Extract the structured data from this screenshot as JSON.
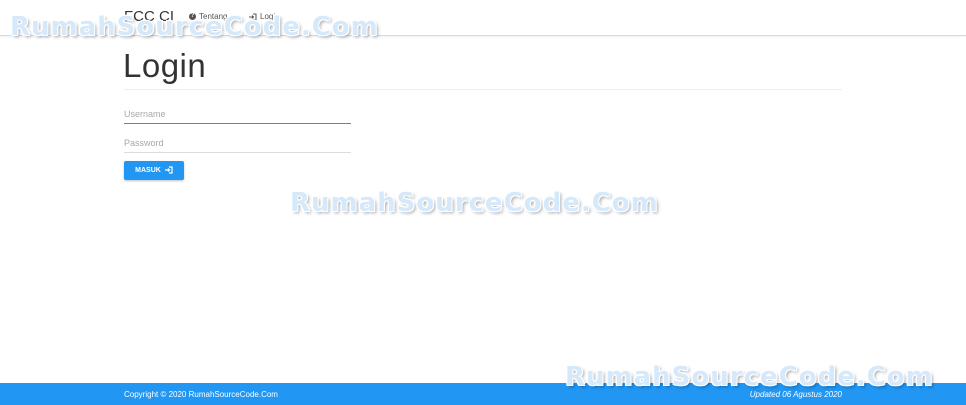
{
  "navbar": {
    "brand": "FCC CI",
    "links": [
      {
        "label": "Tentang",
        "icon": "question-circle-icon"
      },
      {
        "label": "Login",
        "icon": "sign-in-icon"
      }
    ]
  },
  "main": {
    "title": "Login",
    "username": {
      "placeholder": "Username",
      "value": ""
    },
    "password": {
      "placeholder": "Password",
      "value": ""
    },
    "submit_label": "MASUK",
    "submit_icon": "sign-in-icon"
  },
  "footer": {
    "copyright": "Copyright © 2020 RumahSourceCode.Com",
    "updated": "Updated 06 Agustus 2020"
  },
  "watermark": {
    "text": "RumahSourceCode.Com"
  },
  "colors": {
    "accent": "#2196f3"
  }
}
